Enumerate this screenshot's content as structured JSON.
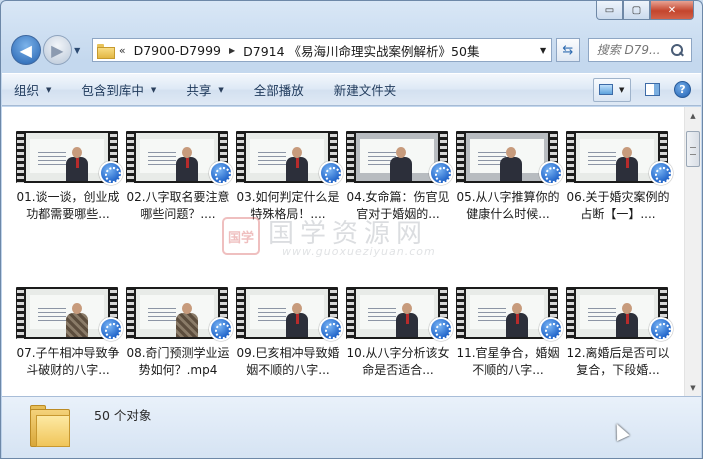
{
  "window": {
    "minimize_glyph": "▭",
    "maximize_glyph": "▢",
    "close_glyph": "✕"
  },
  "address": {
    "chevron": "«",
    "crumbs": [
      "D7900-D7999",
      "D7914 《易海川命理实战案例解析》50集"
    ],
    "search_placeholder": "搜索 D79..."
  },
  "toolbar": {
    "organize": "组织",
    "include_in_library": "包含到库中",
    "share": "共享",
    "play_all": "全部播放",
    "new_folder": "新建文件夹"
  },
  "files": [
    {
      "name": "01.谈一谈，创业成功都需要哪些...",
      "scene": "teacher"
    },
    {
      "name": "02.八字取名要注意哪些问题？....",
      "scene": "teacher"
    },
    {
      "name": "03.如何判定什么是特殊格局！....",
      "scene": "teacher"
    },
    {
      "name": "04.女命篇：伤官见官对于婚姻的...",
      "scene": "dim"
    },
    {
      "name": "05.从八字推算你的健康什么时候...",
      "scene": "dim"
    },
    {
      "name": "06.关于婚灾案例的占断【一】....",
      "scene": "teacher"
    },
    {
      "name": "07.子午相冲导致争斗破财的八字...",
      "scene": "plaid"
    },
    {
      "name": "08.奇门预测学业运势如何？.mp4",
      "scene": "plaid"
    },
    {
      "name": "09.巳亥相冲导致婚姻不顺的八字...",
      "scene": "teacher"
    },
    {
      "name": "10.从八字分析该女命是否适合...",
      "scene": "teacher"
    },
    {
      "name": "11.官星争合，婚姻不顺的八字...",
      "scene": "teacher"
    },
    {
      "name": "12.离婚后是否可以复合，下段婚...",
      "scene": "teacher"
    }
  ],
  "watermark": {
    "seal": "国学",
    "name": "国学资源网",
    "url": "www.guoxueziyuan.com"
  },
  "details": {
    "object_count": "50 个对象"
  },
  "colors": {
    "accent": "#2462b0",
    "frame_bg": "#c4d8ee",
    "close_red": "#c4452d"
  }
}
